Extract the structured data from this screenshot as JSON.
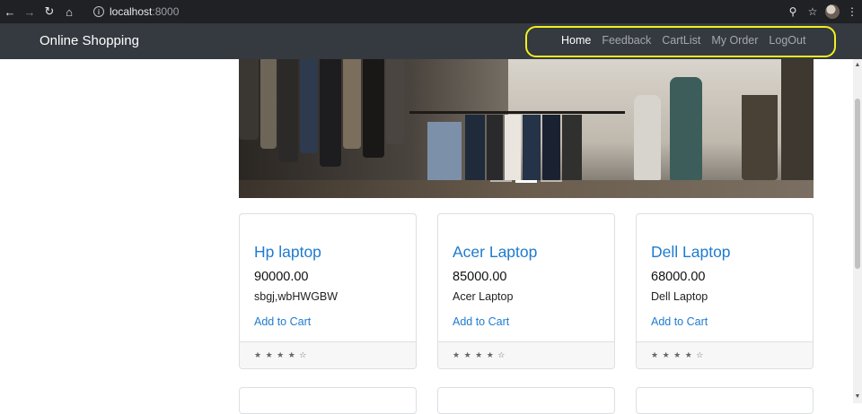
{
  "browser": {
    "url_host": "localhost",
    "url_port": ":8000",
    "icons": [
      "back-icon",
      "forward-icon",
      "reload-icon",
      "home-icon",
      "info-icon",
      "zoom-icon",
      "star-icon",
      "avatar",
      "menu-icon"
    ]
  },
  "navbar": {
    "brand": "Online Shopping",
    "links": [
      {
        "label": "Home",
        "active": true
      },
      {
        "label": "Feedback",
        "active": false
      },
      {
        "label": "CartList",
        "active": false
      },
      {
        "label": "My Order",
        "active": false
      },
      {
        "label": "LogOut",
        "active": false
      }
    ]
  },
  "carousel": {
    "slide_count": 3,
    "active_index": 1
  },
  "products": [
    {
      "name": "Hp laptop",
      "price": "90000.00",
      "description": "sbgj,wbHWGBW",
      "action": "Add to Cart",
      "rating": "★ ★ ★ ★ ☆"
    },
    {
      "name": "Acer Laptop",
      "price": "85000.00",
      "description": "Acer Laptop",
      "action": "Add to Cart",
      "rating": "★ ★ ★ ★ ☆"
    },
    {
      "name": "Dell Laptop",
      "price": "68000.00",
      "description": "Dell Laptop",
      "action": "Add to Cart",
      "rating": "★ ★ ★ ★ ☆"
    }
  ],
  "colors": {
    "navbar_bg": "#343a40",
    "link_blue": "#1f7bd0",
    "highlight": "#f2ef1e"
  }
}
